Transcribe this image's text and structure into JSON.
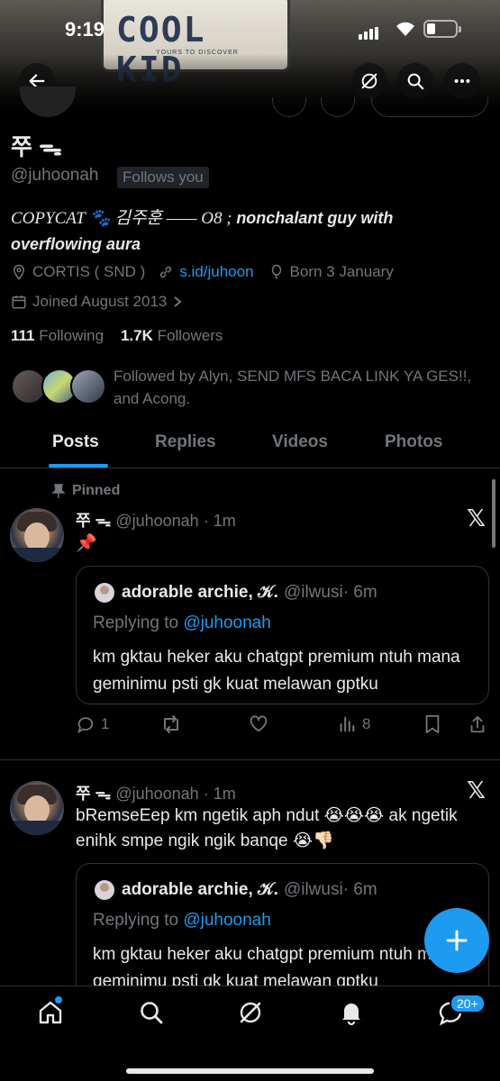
{
  "status_bar": {
    "time": "9:19"
  },
  "banner": {
    "plate_text": "COOL KID",
    "plate_subtext": "YOURS TO DISCOVER"
  },
  "profile": {
    "name": "쭈 ᯓ",
    "handle": "@juhoonah",
    "follows_you": "Follows you",
    "bio_part1": "COPYCAT 🐾 김주훈 —— O8 ; ",
    "bio_part2": "nonchalant guy with overflowing aura",
    "location": "CORTIS ( SND )",
    "website": "s.id/juhoon",
    "birthday": "Born 3 January",
    "joined": "Joined August 2013",
    "following_count": "111",
    "following_label": "Following",
    "followers_count": "1.7K",
    "followers_label": "Followers",
    "followed_by": "Followed by Alyn, SEND MFS BACA LINK YA GES!!, and Acong."
  },
  "tabs": [
    {
      "label": "Posts"
    },
    {
      "label": "Replies"
    },
    {
      "label": "Videos"
    },
    {
      "label": "Photos"
    }
  ],
  "posts": [
    {
      "pinned_label": "Pinned",
      "name": "쭈 ᯓ",
      "handle": "@juhoonah",
      "time": "· 1m",
      "text": "📌",
      "quote": {
        "name": "adorable archie, 𝒦.",
        "handle": "@ilwusi",
        "time": "· 6m",
        "replying_prefix": "Replying to",
        "replying_handle": "@juhoonah",
        "text": "km gktau heker aku chatgpt premium ntuh mana geminimu psti gk kuat melawan gptku"
      },
      "replies": "1",
      "reposts": "",
      "likes": "",
      "views": "8"
    },
    {
      "name": "쭈 ᯓ",
      "handle": "@juhoonah",
      "time": "· 1m",
      "text": "bRemseEep km ngetik aph ndut 😭😭😭 ak ngetik enihk smpe ngik ngik banqe 😭👎🏻",
      "quote": {
        "name": "adorable archie, 𝒦.",
        "handle": "@ilwusi",
        "time": "· 6m",
        "replying_prefix": "Replying to",
        "replying_handle": "@juhoonah",
        "text": "km gktau heker aku chatgpt premium ntuh mana geminimu psti gk kuat melawan gptku"
      }
    }
  ],
  "bottom_nav": {
    "notification_badge": "20+"
  },
  "colors": {
    "accent": "#1d9bf0",
    "background": "#000000",
    "muted": "#71767b"
  }
}
